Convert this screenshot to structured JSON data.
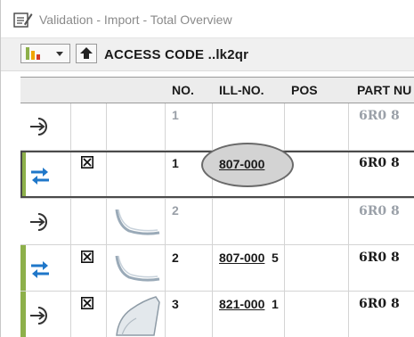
{
  "window": {
    "title": "Validation - Import - Total Overview"
  },
  "toolbar": {
    "access_code": "ACCESS CODE ..lk2qr"
  },
  "table": {
    "headers": {
      "no": "NO.",
      "ill_no": "ILL-NO.",
      "pos": "POS",
      "part_no": "PART NU"
    },
    "rows": [
      {
        "no": "1",
        "ill_no": "",
        "pos": "",
        "part": "6R0 8",
        "checked": false,
        "icon": "arrow-into-circle-icon",
        "selected": false,
        "highlight": false
      },
      {
        "no": "1",
        "ill_no": "807-000",
        "pos": "1",
        "part": "6R0 8",
        "checked": true,
        "icon": "swap-arrows-icon",
        "selected": true,
        "highlight": true
      },
      {
        "no": "2",
        "ill_no": "",
        "pos": "",
        "part": "6R0 8",
        "checked": false,
        "icon": "arrow-into-circle-icon",
        "selected": false,
        "highlight": false
      },
      {
        "no": "2",
        "ill_no": "807-000",
        "pos": "5",
        "part": "6R0 8",
        "checked": true,
        "icon": "swap-arrows-icon",
        "selected": false,
        "highlight": true
      },
      {
        "no": "3",
        "ill_no": "821-000",
        "pos": "1",
        "part": "6R0 8",
        "checked": true,
        "icon": "arrow-into-circle-icon",
        "selected": false,
        "highlight": true
      }
    ]
  },
  "colors": {
    "accent_green": "#8db04a",
    "swap_blue": "#1f77c9",
    "highlight_ellipse": "#d3d3d3"
  }
}
